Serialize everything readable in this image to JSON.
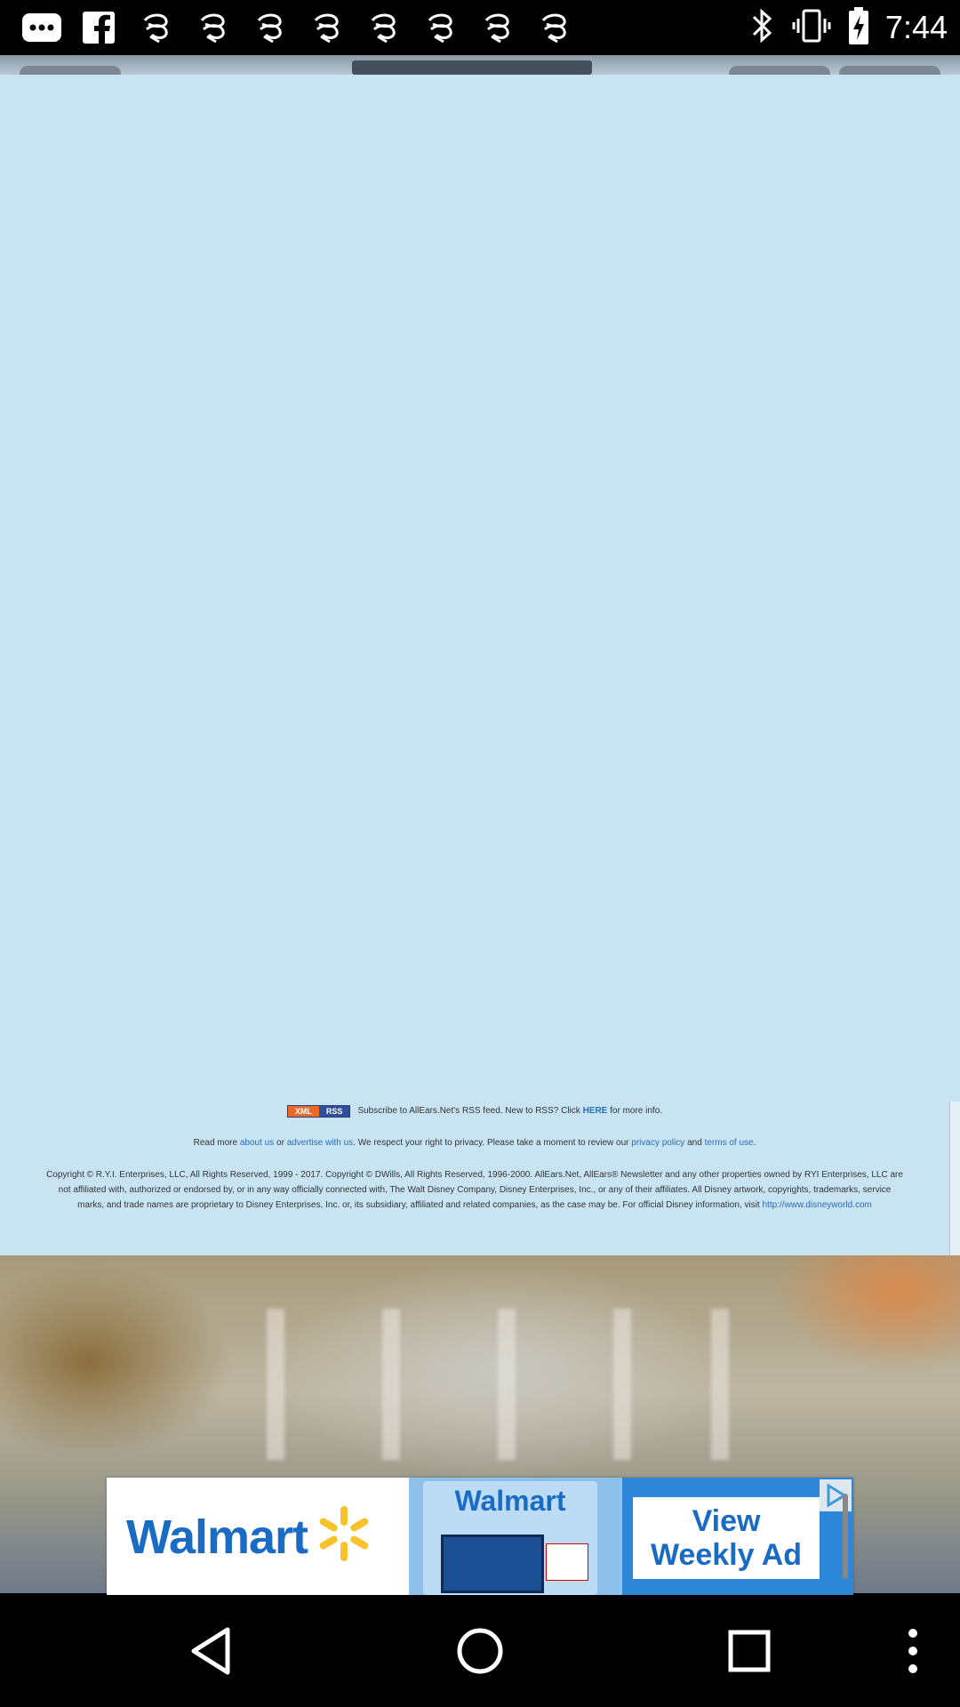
{
  "status_bar": {
    "time": "7:44",
    "left_icons": [
      "more-dots-icon",
      "facebook-icon",
      "spiral-notification-icon",
      "spiral-notification-icon",
      "spiral-notification-icon",
      "spiral-notification-icon",
      "spiral-notification-icon",
      "spiral-notification-icon",
      "spiral-notification-icon",
      "spiral-notification-icon"
    ],
    "right_icons": [
      "bluetooth-icon",
      "vibrate-icon",
      "battery-charging-icon"
    ]
  },
  "footer": {
    "rss_badge_left": "XML",
    "rss_badge_right": "RSS",
    "rss_text_before": "Subscribe to AllEars.Net's RSS feed. New to RSS? Click ",
    "rss_link": "HERE",
    "rss_text_after": " for more info.",
    "read_more_before": "Read more ",
    "about_link": "about us",
    "read_more_or": " or ",
    "advertise_link": "advertise with us",
    "privacy_text": ". We respect your right to privacy. Please take a moment to review our ",
    "privacy_link": "privacy policy",
    "and_text": " and ",
    "terms_link": "terms of use",
    "terms_end": ".",
    "copyright": "Copyright © R.Y.I. Enterprises, LLC, All Rights Reserved, 1999 - 2017. Copyright © DWills, All Rights Reserved, 1996-2000. AllEars.Net, AllEars® Newsletter and any other properties owned by RYI Enterprises, LLC are not affiliated with, authorized or endorsed by, or in any way officially connected with, The Walt Disney Company, Disney Enterprises, Inc., or any of their affiliates. All Disney artwork, copyrights, trademarks, service marks, and trade names are proprietary to Disney Enterprises, Inc. or, its subsidiary, affiliated and related companies, as the case may be. For official Disney information, visit ",
    "disney_link": "http://www.disneyworld.com"
  },
  "ad": {
    "brand": "Walmart",
    "mid_title": "Walmart",
    "cta_line1": "View",
    "cta_line2": "Weekly Ad",
    "colors": {
      "brand_blue": "#1a6bc4",
      "spark_yellow": "#f7c22b",
      "banner_blue": "#2e86d8"
    }
  },
  "nav_bar": {
    "buttons": [
      "back-icon",
      "home-icon",
      "recents-icon",
      "overflow-menu-icon"
    ]
  },
  "colors": {
    "page_bg": "#c8e4f2",
    "link": "#2a6db8",
    "status_bg": "#000000"
  }
}
